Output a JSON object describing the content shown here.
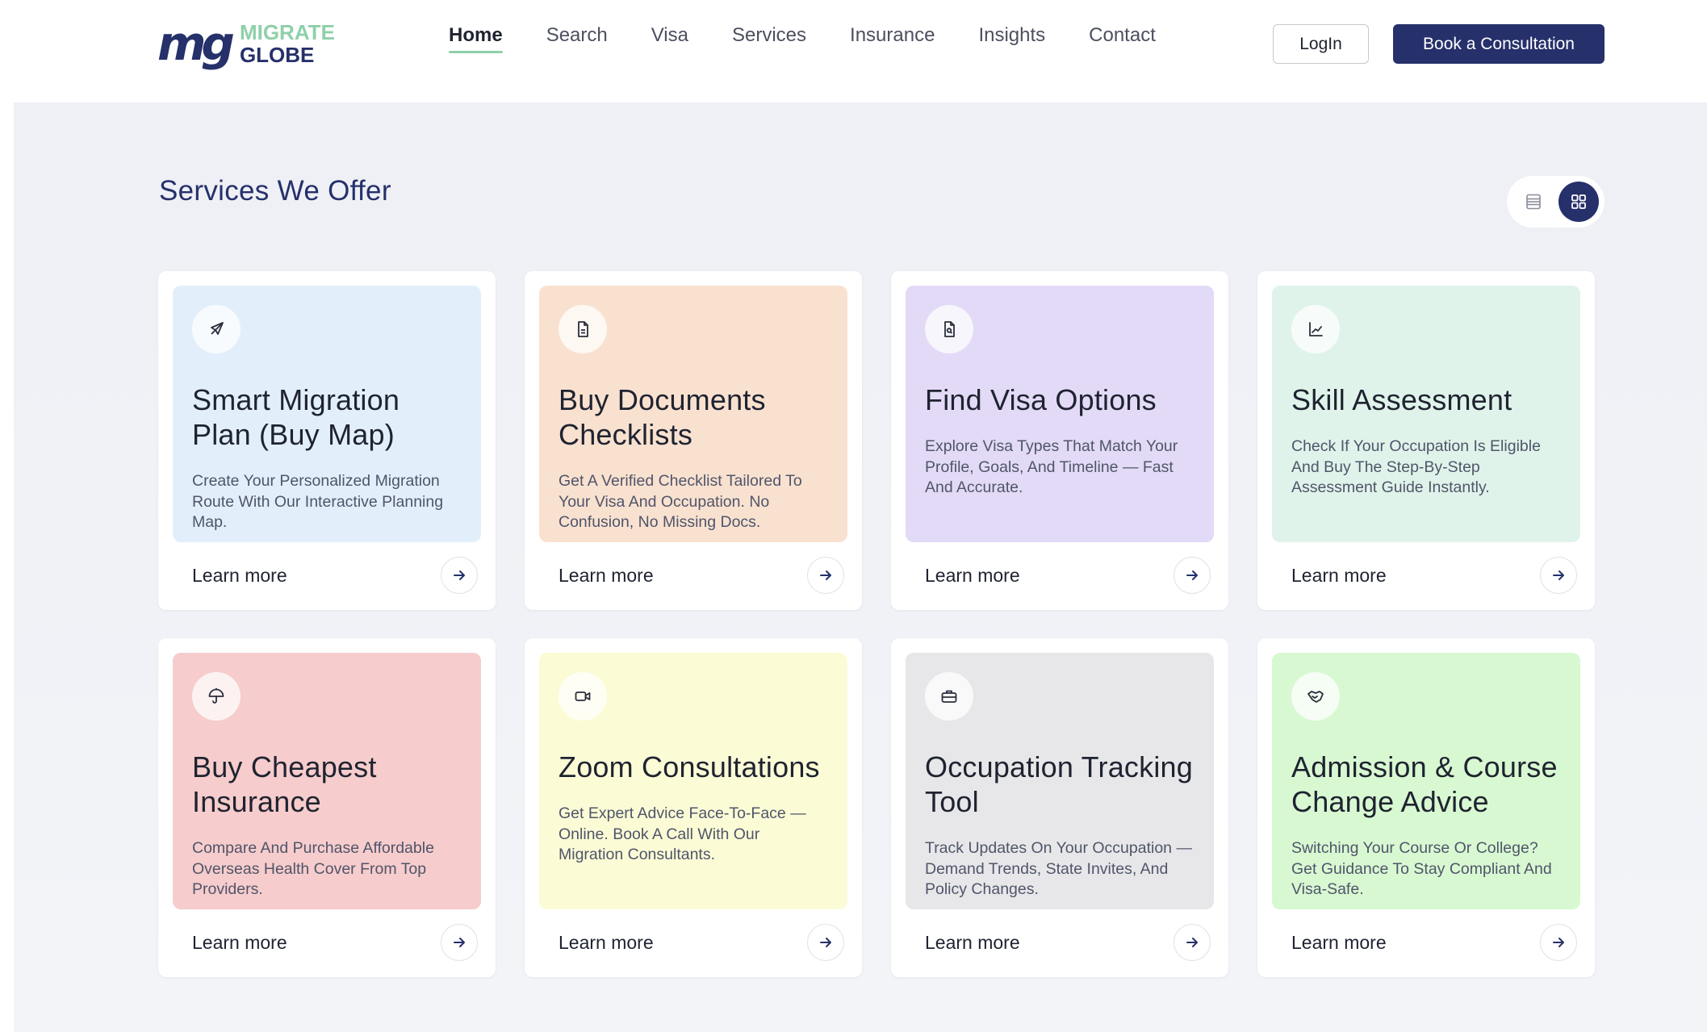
{
  "brand": {
    "mark": "mg",
    "line1": "MIGRATE",
    "line2": "GLOBE",
    "mark_color": "#26306a",
    "accent_color": "#8fd0a9"
  },
  "nav": {
    "items": [
      {
        "label": "Home",
        "active": true
      },
      {
        "label": "Search"
      },
      {
        "label": "Visa"
      },
      {
        "label": "Services"
      },
      {
        "label": "Insurance"
      },
      {
        "label": "Insights"
      },
      {
        "label": "Contact"
      }
    ]
  },
  "header": {
    "login_label": "LogIn",
    "book_label": "Book a Consultation"
  },
  "section": {
    "title": "Services We Offer",
    "view_modes": [
      {
        "icon": "list-view-icon",
        "active": false
      },
      {
        "icon": "grid-view-icon",
        "active": true
      }
    ]
  },
  "cards": [
    {
      "title": "Smart Migration Plan (Buy Map)",
      "desc": "Create Your Personalized Migration Route With Our Interactive Planning Map.",
      "icon": "plane-icon",
      "bg": "#e2effb",
      "cta": "Learn more"
    },
    {
      "title": "Buy Documents Checklists",
      "desc": "Get A Verified Checklist Tailored To Your Visa And Occupation. No Confusion, No Missing Docs.",
      "icon": "document-icon",
      "bg": "#f9e1d0",
      "cta": "Learn more"
    },
    {
      "title": "Find Visa Options",
      "desc": "Explore Visa Types That Match Your Profile, Goals, And Timeline — Fast And Accurate.",
      "icon": "file-search-icon",
      "bg": "#e2daf6",
      "cta": "Learn more"
    },
    {
      "title": "Skill Assessment",
      "desc": "Check If Your Occupation Is Eligible And Buy The Step-By-Step Assessment Guide Instantly.",
      "icon": "chart-icon",
      "bg": "#dff3ea",
      "cta": "Learn more"
    },
    {
      "title": "Buy Cheapest Insurance",
      "desc": "Compare And Purchase Affordable Overseas Health Cover From Top Providers.",
      "icon": "umbrella-icon",
      "bg": "#f6cccc",
      "cta": "Learn more"
    },
    {
      "title": "Zoom Consultations",
      "desc": "Get Expert Advice Face-To-Face — Online. Book A Call With Our Migration Consultants.",
      "icon": "video-icon",
      "bg": "#fbfcd6",
      "cta": "Learn more"
    },
    {
      "title": "Occupation Tracking Tool",
      "desc": "Track Updates On Your Occupation — Demand Trends, State Invites, And Policy Changes.",
      "icon": "briefcase-icon",
      "bg": "#e7e7e9",
      "cta": "Learn more"
    },
    {
      "title": "Admission & Course Change Advice",
      "desc": "Switching Your Course Or College? Get Guidance To Stay Compliant And Visa-Safe.",
      "icon": "handshake-icon",
      "bg": "#d8f8d2",
      "cta": "Learn more"
    }
  ]
}
